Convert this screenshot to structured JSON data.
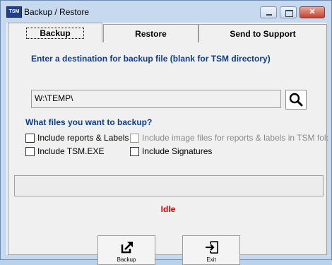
{
  "window": {
    "title": "Backup / Restore",
    "app_icon": "TSM"
  },
  "tabs": [
    {
      "label": "Backup",
      "selected": true
    },
    {
      "label": "Restore",
      "selected": false
    },
    {
      "label": "Send to Support",
      "selected": false
    }
  ],
  "backup": {
    "destination_heading": "Enter a destination for backup file (blank for TSM directory)",
    "destination_value": "W:\\TEMP\\",
    "files_heading": "What files you want to backup?",
    "options": {
      "reports_labels": {
        "label": "Include reports & Labels",
        "checked": false,
        "enabled": true
      },
      "image_files": {
        "label": "Include image files for reports & labels in TSM folder",
        "checked": false,
        "enabled": false
      },
      "tsm_exe": {
        "label": "Include TSM.EXE",
        "checked": false,
        "enabled": true
      },
      "signatures": {
        "label": "Include Signatures",
        "checked": false,
        "enabled": true
      }
    },
    "status": "Idle",
    "backup_button": "Backup",
    "exit_button": "Exit"
  },
  "colors": {
    "heading": "#0a3d8f",
    "status": "#e00000",
    "window_frame": "#c6d9ef"
  },
  "icons": [
    "app-icon",
    "minimize-icon",
    "maximize-icon",
    "close-icon",
    "search-icon",
    "export-icon",
    "exit-icon"
  ]
}
